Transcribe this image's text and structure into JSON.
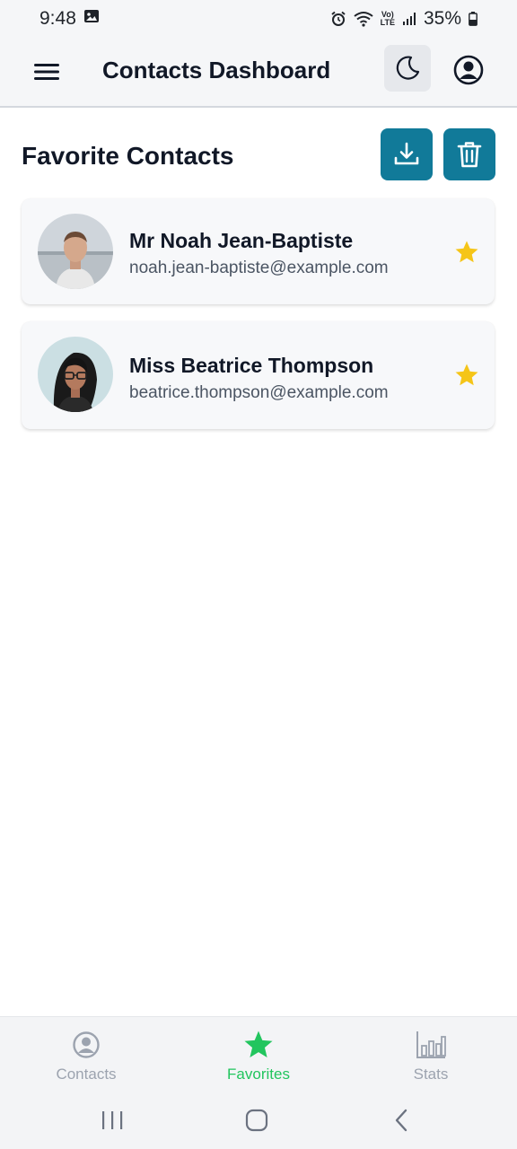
{
  "status_bar": {
    "time": "9:48",
    "battery": "35%",
    "lte_label_top": "Vo)",
    "lte_label_bottom": "LTE"
  },
  "app_bar": {
    "title": "Contacts Dashboard"
  },
  "section": {
    "title": "Favorite Contacts"
  },
  "contacts": [
    {
      "name": "Mr Noah Jean-Baptiste",
      "email": "noah.jean-baptiste@example.com",
      "favorite": true
    },
    {
      "name": "Miss Beatrice Thompson",
      "email": "beatrice.thompson@example.com",
      "favorite": true
    }
  ],
  "bottom_nav": {
    "items": [
      {
        "label": "Contacts",
        "icon": "user-circle-icon",
        "active": false
      },
      {
        "label": "Favorites",
        "icon": "star-icon",
        "active": true
      },
      {
        "label": "Stats",
        "icon": "bar-chart-icon",
        "active": false
      }
    ]
  },
  "colors": {
    "accent": "#117a99",
    "star": "#f5c518",
    "active_nav": "#22c55e",
    "inactive_nav": "#9ca3af"
  }
}
